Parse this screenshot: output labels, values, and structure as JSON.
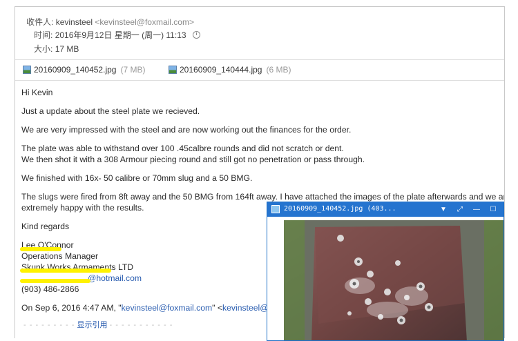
{
  "header": {
    "sender_label": "收件人:",
    "sender_name": "kevinsteel",
    "sender_email": "<kevinsteel@foxmail.com>",
    "time_label": "时间:",
    "time_value": "2016年9月12日 星期一 (周一) 11:13",
    "size_label": "大小:",
    "size_value": "17 MB"
  },
  "attachments": [
    {
      "name": "20160909_140452.jpg",
      "size": "(7 MB)"
    },
    {
      "name": "20160909_140444.jpg",
      "size": "(6 MB)"
    }
  ],
  "body": {
    "greeting": "Hi Kevin",
    "p1": "Just a update about the steel plate we recieved.",
    "p2": "We are very impressed with the steel and are now working out the finances for the order.",
    "p3a": "The plate was able to withstand over 100 .45calbre rounds and did not scratch or dent.",
    "p3b": "We then shot it with a 308 Armour piecing round and still got no penetration or pass through.",
    "p4": "We finished with 16x- 50 calibre or 70mm slug and a 50 BMG.",
    "p5a": "The slugs were fired from 8ft away and the 50 BMG from 164ft away. I have attached the images of the plate afterwards and we are",
    "p5b": "extremely happy with the results.",
    "closing": "Kind regards",
    "sig_name": "Lee O'Connor",
    "sig_title": "Operations Manager",
    "sig_company": "Skunk Works Armaments LTD",
    "sig_email": "@hotmail.com",
    "sig_phone": "(903) 486-2866",
    "reply_prefix": "On Sep 6, 2016 4:47 AM, \"",
    "reply_email": "kevinsteel@foxmail.com",
    "reply_mid": "\" <",
    "reply_email2": "kevinsteel@fo"
  },
  "quote_toggle": "显示引用",
  "viewer": {
    "title": "20160909_140452.jpg (403...",
    "buttons": {
      "dropdown": "▼",
      "fit": "⤢",
      "minimize": "—",
      "maximize": "☐"
    }
  },
  "colors": {
    "accent": "#2574cf",
    "link": "#2a5db0",
    "highlight": "#fff200"
  }
}
